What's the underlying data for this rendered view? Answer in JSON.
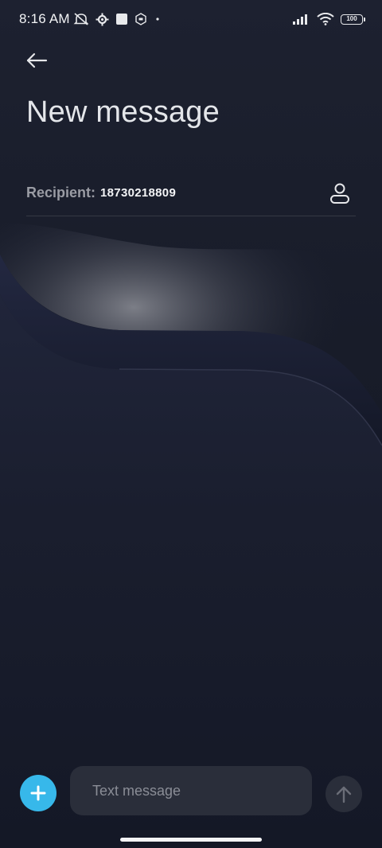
{
  "status_bar": {
    "time": "8:16 AM",
    "battery_level": "100",
    "icons_left": [
      "mute-icon",
      "settings-gear-icon",
      "square-icon",
      "hexagon-icon",
      "dot-icon"
    ],
    "icons_right": [
      "signal-icon",
      "wifi-icon",
      "battery-icon"
    ]
  },
  "header": {
    "back_icon": "arrow-left-icon",
    "title": "New message"
  },
  "recipient": {
    "label": "Recipient:",
    "value": "18730218809",
    "contact_icon": "person-icon"
  },
  "composer": {
    "add_icon": "plus-icon",
    "placeholder": "Text message",
    "send_icon": "arrow-up-icon"
  },
  "colors": {
    "accent": "#37b8ea",
    "background": "#161a26",
    "input_background": "#2a2e3a"
  }
}
